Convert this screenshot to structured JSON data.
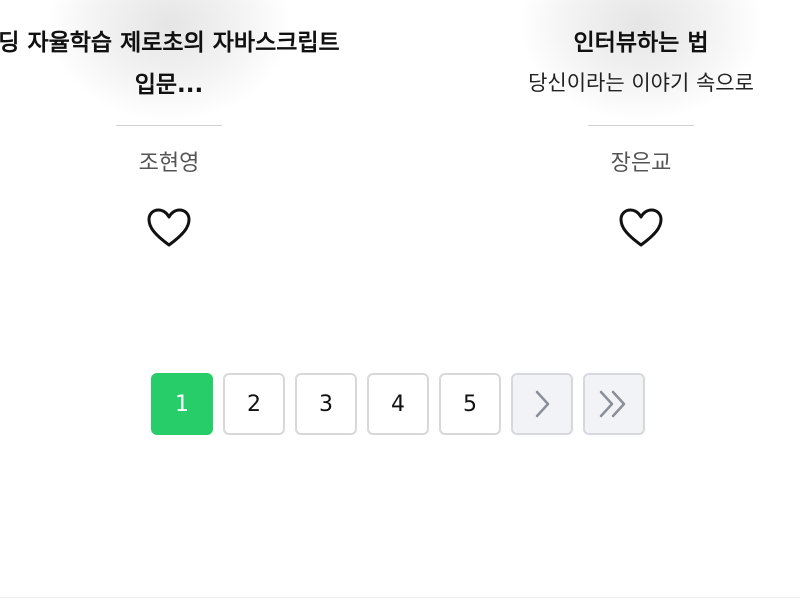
{
  "books": [
    {
      "title": "딩 자율학습 제로초의 자바스크립트",
      "subtitle": "입문...",
      "author": "조현영",
      "like_icon": "heart-outline-icon"
    },
    {
      "title": "인터뷰하는 법",
      "subtitle": "당신이라는 이야기 속으로",
      "author": "장은교",
      "like_icon": "heart-outline-icon"
    }
  ],
  "pagination": {
    "pages": [
      "1",
      "2",
      "3",
      "4",
      "5"
    ],
    "current": "1",
    "active_color": "#27cd68",
    "next_icon": "chevron-right-icon",
    "last_icon": "double-chevron-right-icon"
  }
}
